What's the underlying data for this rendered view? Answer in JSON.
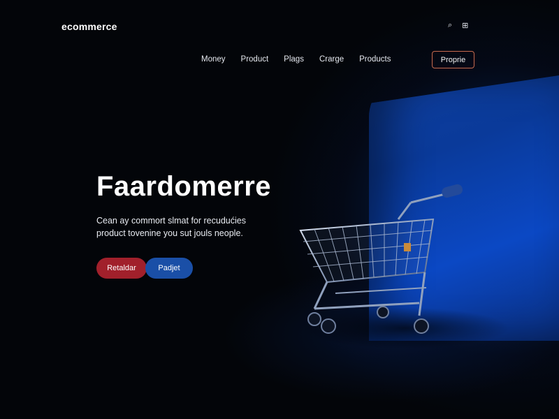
{
  "brand": {
    "logo": "ecommerce"
  },
  "utility_icons": [
    {
      "name": "search-icon",
      "glyph": "⌕"
    },
    {
      "name": "cart-icon",
      "glyph": "⊞"
    }
  ],
  "nav": {
    "items": [
      "Money",
      "Product",
      "Plags",
      "Crarge",
      "Products"
    ],
    "cta_label": "Proprie"
  },
  "hero": {
    "title": "Faardomerre",
    "copy_line1": "Cean ay commort slmat for recudućies",
    "copy_line2": "product tovenine you sut jouls neople.",
    "primary_button": "Retaldar",
    "secondary_button": "Padjet"
  },
  "colors": {
    "background": "#030509",
    "panel_blue": "#0b48c4",
    "primary_red": "#a1202b",
    "secondary_blue": "#1a4fa7",
    "outline_accent": "#c96a4e"
  },
  "illustration": {
    "subject": "shopping-cart"
  }
}
